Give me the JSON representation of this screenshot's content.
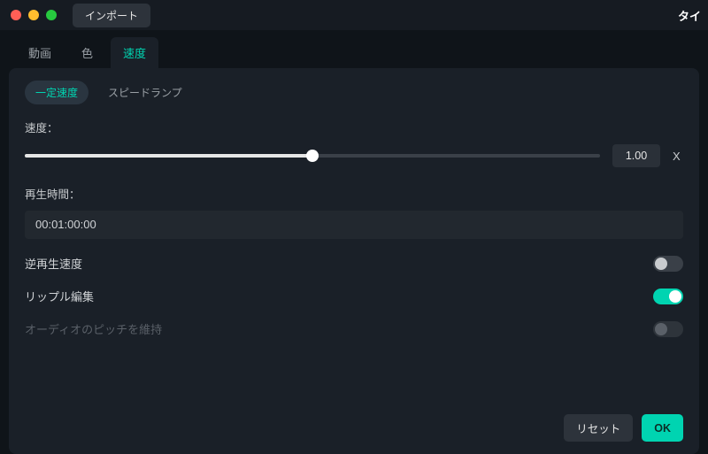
{
  "titlebar": {
    "import_label": "インポート",
    "title_right": "タイ"
  },
  "tabs": [
    {
      "label": "動画",
      "active": false
    },
    {
      "label": "色",
      "active": false
    },
    {
      "label": "速度",
      "active": true
    }
  ],
  "subtabs": [
    {
      "label": "一定速度",
      "active": true
    },
    {
      "label": "スピードランプ",
      "active": false
    }
  ],
  "speed": {
    "label": "速度：",
    "value": "1.00",
    "unit": "X",
    "slider_percent": 50
  },
  "duration": {
    "label": "再生時間：",
    "value": "00:01:00:00"
  },
  "toggles": {
    "reverse": {
      "label": "逆再生速度",
      "on": false,
      "disabled": false
    },
    "ripple": {
      "label": "リップル編集",
      "on": true,
      "disabled": false
    },
    "pitch": {
      "label": "オーディオのピッチを維持",
      "on": false,
      "disabled": true
    }
  },
  "footer": {
    "reset_label": "リセット",
    "ok_label": "OK"
  }
}
